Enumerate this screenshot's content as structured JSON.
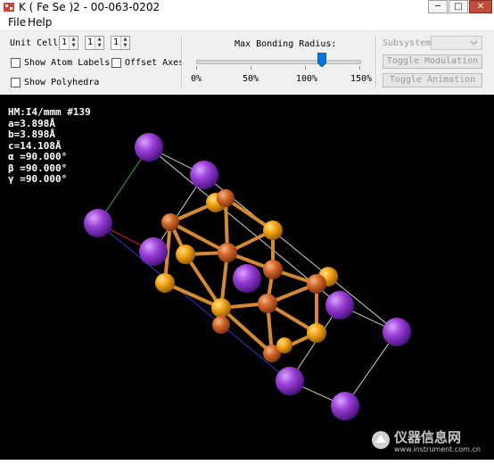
{
  "window": {
    "title": "K ( Fe Se )2 - 00-063-0202",
    "controls": {
      "minimize": "─",
      "maximize": "□",
      "close": "✕"
    }
  },
  "menu": {
    "file": "File",
    "help": "Help"
  },
  "toolbar": {
    "unit_cell_label": "Unit Cell:",
    "unit_cell_values": [
      "1",
      "1",
      "1"
    ],
    "show_atom_labels": "Show Atom Labels",
    "offset_axes": "Offset Axes",
    "show_polyhedra": "Show Polyhedra",
    "max_bonding_radius_label": "Max Bonding Radius:",
    "slider_ticks": [
      "0%",
      "50%",
      "100%",
      "150%"
    ],
    "slider_value_percent": 115,
    "subsystem_label": "Subsystem:",
    "subsystem_value": "",
    "toggle_modulation": "Toggle Modulation",
    "toggle_animation": "Toggle Animation"
  },
  "crystal_info": {
    "hm": "HM:I4/mmm #139",
    "a": "a=3.898Å",
    "b": "b=3.898Å",
    "c": "c=14.108Å",
    "alpha": "α =90.000°",
    "beta": "β =90.000°",
    "gamma": "γ =90.000°"
  },
  "colors": {
    "potassium": "#8a35c8",
    "iron": "#d2672a",
    "selenium": "#f3a316",
    "background": "#000000"
  },
  "watermark": {
    "cn": "仪器信息网",
    "en": "www.instrument.com.cn"
  }
}
